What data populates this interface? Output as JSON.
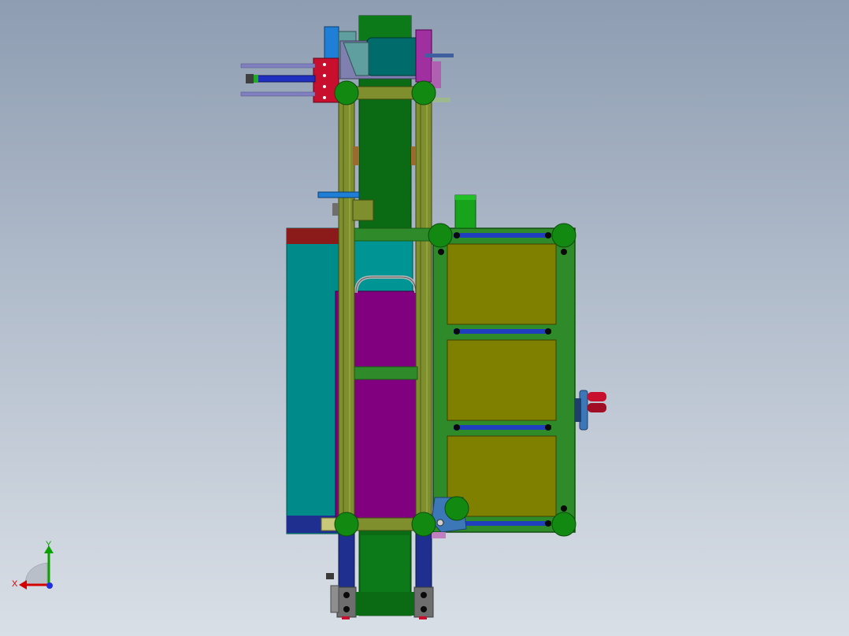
{
  "viewport": {
    "background_top": "#8e9db2",
    "background_bottom": "#d9dfe6"
  },
  "model": {
    "colors": {
      "frame": "#7f8f2e",
      "frame_dark": "#4f5a14",
      "green_frame": "#2f8a2a",
      "node": "#128a12",
      "teal": "#008b8b",
      "magenta": "#800080",
      "olive_panel": "#808000",
      "dark_green": "#0a6b14",
      "blue": "#1f3fbf",
      "red": "#c8102e",
      "maroon": "#8b1a1a",
      "grey": "#6e6e6e"
    }
  },
  "triad": {
    "x_label": "X",
    "y_label": "Y",
    "x_color": "#d40000",
    "y_color": "#0aa000",
    "z_color": "#1f2fe0"
  }
}
